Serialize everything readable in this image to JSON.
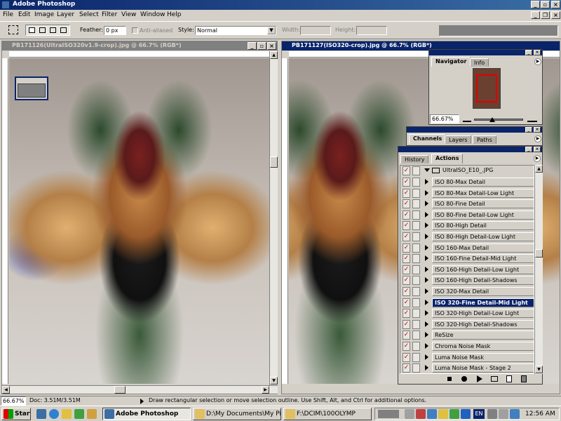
{
  "app": {
    "title": "Adobe Photoshop"
  },
  "menu": [
    "File",
    "Edit",
    "Image",
    "Layer",
    "Select",
    "Filter",
    "View",
    "Window",
    "Help"
  ],
  "options": {
    "feather_label": "Feather:",
    "feather_value": "0 px",
    "antialiased_label": "Anti-aliased",
    "style_label": "Style:",
    "style_value": "Normal",
    "width_label": "Width:",
    "height_label": "Height:"
  },
  "doc1": {
    "title": "PB171126(UltraISO320v1.9-crop).jpg @ 66.7% (RGB*)"
  },
  "doc2": {
    "title": "PB171127(ISO320-crop).jpg @ 66.7% (RGB*)"
  },
  "navigator": {
    "tabs": [
      "Navigator",
      "Info"
    ],
    "zoom": "66.67%"
  },
  "channels": {
    "tabs": [
      "Channels",
      "Layers",
      "Paths"
    ]
  },
  "actions": {
    "tabs": [
      "History",
      "Actions"
    ],
    "set_name": "UltraISO_E10_.JPG",
    "items": [
      "ISO  80-Max Detail",
      "ISO  80-Max Detail-Low Light",
      "ISO  80-Fine Detail",
      "ISO  80-Fine Detail-Low Light",
      "ISO  80-High Detail",
      "ISO  80-High Detail-Low Light",
      "ISO 160-Max Detail",
      "ISO 160-Fine Detail-Mid Light",
      "ISO 160-High Detail-Low Light",
      "ISO 160-High Detail-Shadows",
      "ISO 320-Max Detail",
      "ISO 320-Fine Detail-Mid Light",
      "ISO 320-High Detail-Low Light",
      "ISO 320-High Detail-Shadows",
      "ReSize",
      "Chroma Noise Mask",
      "Luma Noise Mask",
      "Luma Noise Mask - Stage 2"
    ],
    "selected_index": 11
  },
  "status": {
    "zoom": "66.67%",
    "doc": "Doc: 3.51M/3.51M",
    "hint": "Draw rectangular selection or move selection outline.  Use Shift, Alt, and Ctrl for additional options."
  },
  "taskbar": {
    "start": "Start",
    "tasks": [
      "Adobe Photoshop",
      "D:\\My Documents\\My Pict...",
      "F:\\DCIM\\100OLYMP"
    ],
    "clock": "12:56 AM",
    "lang": "EN"
  }
}
